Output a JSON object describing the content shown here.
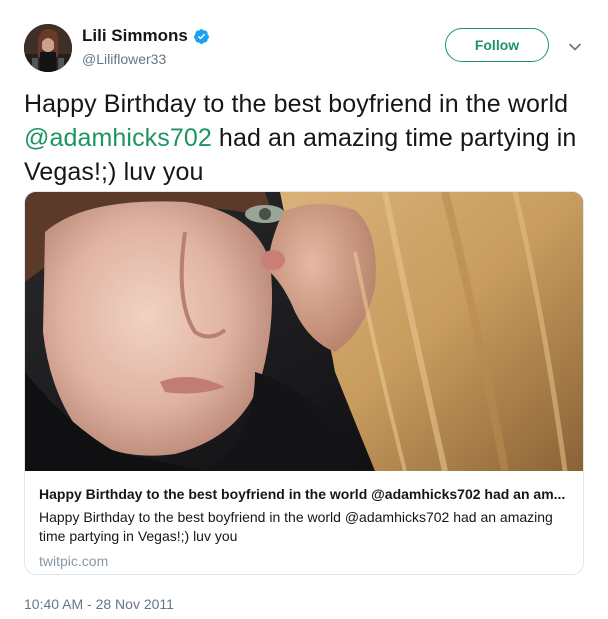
{
  "author": {
    "display_name": "Lili Simmons",
    "handle": "@Liliflower33",
    "verified": true
  },
  "follow_button": {
    "label": "Follow"
  },
  "tweet": {
    "text_before": "Happy Birthday to the best boyfriend in the world ",
    "mention": "@adamhicks702",
    "text_after": " had an amazing time partying in Vegas!;) luv you"
  },
  "card": {
    "title": "Happy Birthday to the best boyfriend in the world @adamhicks702 had an am...",
    "description": "Happy Birthday to the best boyfriend in the world @adamhicks702 had an amazing time partying in Vegas!;) luv you",
    "domain": "twitpic.com"
  },
  "timestamp": "10:40 AM - 28 Nov 2011",
  "colors": {
    "accent": "#1c9564",
    "verified": "#1da1f2",
    "secondary_text": "#657786"
  },
  "icons": {
    "verified": "verified-badge-icon",
    "menu": "chevron-down-icon"
  }
}
